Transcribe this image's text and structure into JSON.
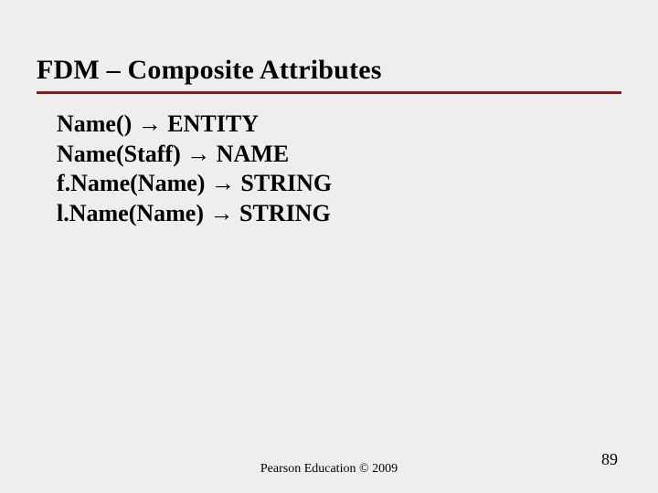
{
  "title": "FDM – Composite Attributes",
  "lines": [
    "Name() → ENTITY",
    "Name(Staff) → NAME",
    "f.Name(Name) → STRING",
    "l.Name(Name) → STRING"
  ],
  "footer": "Pearson Education © 2009",
  "page": "89"
}
